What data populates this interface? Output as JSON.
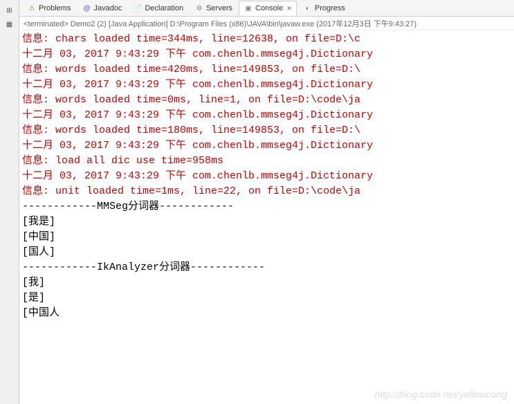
{
  "toolbar": {
    "icon1": "⊞",
    "icon2": "▦"
  },
  "tabs": [
    {
      "icon": "⚠",
      "icon_color": "#c80",
      "label": "Problems"
    },
    {
      "icon": "@",
      "icon_color": "#36c",
      "label": "Javadoc"
    },
    {
      "icon": "📄",
      "icon_color": "#888",
      "label": "Declaration"
    },
    {
      "icon": "⚙",
      "icon_color": "#888",
      "label": "Servers"
    },
    {
      "icon": "▣",
      "icon_color": "#888",
      "label": "Console",
      "active": true,
      "closable": true
    },
    {
      "icon": "◐",
      "icon_color": "#3a3",
      "label": "Progress"
    }
  ],
  "terminated_line": "<terminated> Demo2 (2) [Java Application] D:\\Program Files (x86)\\JAVA\\bin\\javaw.exe (2017年12月3日 下午9:43:27)",
  "lines": [
    {
      "cls": "red",
      "text": "信息: chars loaded time=344ms, line=12638, on file=D:\\c"
    },
    {
      "cls": "red",
      "text": "十二月 03, 2017 9:43:29 下午 com.chenlb.mmseg4j.Dictionary"
    },
    {
      "cls": "red",
      "text": "信息: words loaded time=420ms, line=149853, on file=D:\\"
    },
    {
      "cls": "red",
      "text": "十二月 03, 2017 9:43:29 下午 com.chenlb.mmseg4j.Dictionary"
    },
    {
      "cls": "red",
      "text": "信息: words loaded time=0ms, line=1, on file=D:\\code\\ja"
    },
    {
      "cls": "red",
      "text": "十二月 03, 2017 9:43:29 下午 com.chenlb.mmseg4j.Dictionary"
    },
    {
      "cls": "red",
      "text": "信息: words loaded time=180ms, line=149853, on file=D:\\"
    },
    {
      "cls": "red",
      "text": "十二月 03, 2017 9:43:29 下午 com.chenlb.mmseg4j.Dictionary"
    },
    {
      "cls": "red",
      "text": "信息: load all dic use time=958ms"
    },
    {
      "cls": "red",
      "text": "十二月 03, 2017 9:43:29 下午 com.chenlb.mmseg4j.Dictionary"
    },
    {
      "cls": "red",
      "text": "信息: unit loaded time=1ms, line=22, on file=D:\\code\\ja"
    },
    {
      "cls": "black",
      "text": "------------MMSeg分词器------------"
    },
    {
      "cls": "black",
      "text": "[我是]"
    },
    {
      "cls": "black",
      "text": "[中国]"
    },
    {
      "cls": "black",
      "text": "[国人]"
    },
    {
      "cls": "black",
      "text": "------------IkAnalyzer分词器------------"
    },
    {
      "cls": "black",
      "text": "[我]"
    },
    {
      "cls": "black",
      "text": "[是]"
    },
    {
      "cls": "black",
      "text": "[中国人"
    }
  ],
  "watermark": "http://blog.csdn.net/yellowcong"
}
